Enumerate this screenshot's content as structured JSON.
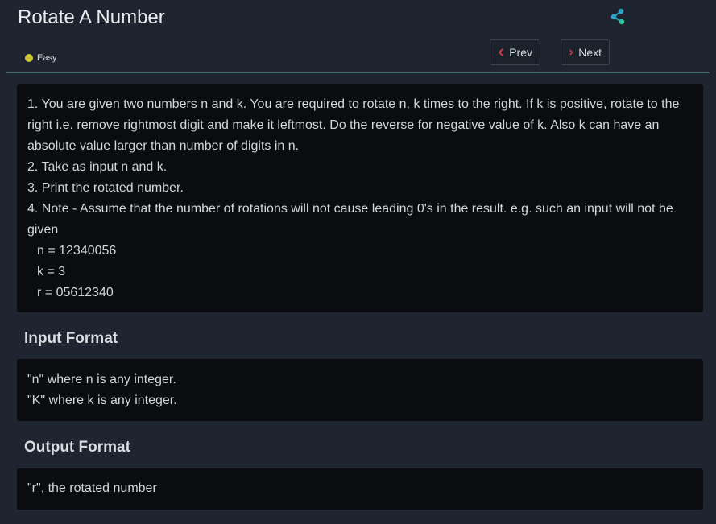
{
  "header": {
    "title": "Rotate A Number",
    "difficulty": "Easy",
    "prev_label": "Prev",
    "next_label": "Next"
  },
  "description": {
    "lines": [
      "1. You are given two numbers n and k. You are required to rotate n, k times to the right. If k is positive, rotate to the right i.e. remove rightmost digit and make it leftmost. Do the reverse for negative value of k. Also k can have an absolute value larger than number of digits in n.",
      "2. Take as input n and k.",
      "3. Print the rotated number.",
      "4. Note - Assume that the number of rotations will not cause leading 0's in the result. e.g. such an input will not be given"
    ],
    "example": [
      "n = 12340056",
      "k = 3",
      "r = 05612340"
    ]
  },
  "input_format": {
    "title": "Input Format",
    "lines": [
      "\"n\" where n is any integer.",
      "\"K\" where k is any integer."
    ]
  },
  "output_format": {
    "title": "Output Format",
    "lines": [
      "\"r\", the rotated number"
    ]
  },
  "colors": {
    "background": "#1f2530",
    "panel": "#0b0c10",
    "easy_dot": "#c7c32a",
    "nav_arrow": "#e0394a",
    "share": "#2ea6c9"
  }
}
